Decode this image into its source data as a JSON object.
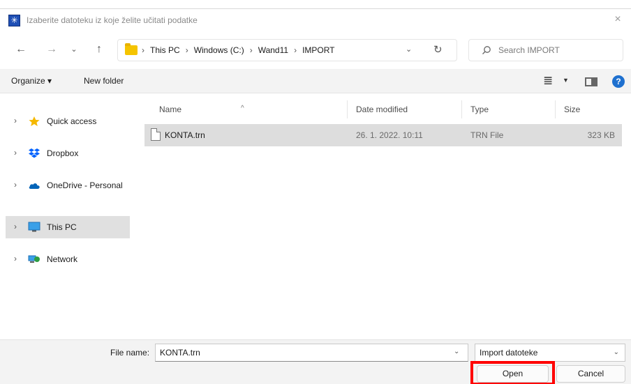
{
  "titlebar": {
    "title": "Izaberite datoteku iz koje želite učitati podatke",
    "close_glyph": "×",
    "app_icon_glyph": "✳"
  },
  "nav": {
    "back_glyph": "←",
    "forward_glyph": "→",
    "recent_glyph": "⌄",
    "up_glyph": "↑",
    "breadcrumbs": [
      "This PC",
      "Windows (C:)",
      "Wand11",
      "IMPORT"
    ],
    "crumb_sep": "›",
    "leading_sep": "›",
    "address_dropdown_glyph": "⌄",
    "refresh_glyph": "↻",
    "search_placeholder": "Search IMPORT"
  },
  "toolbar": {
    "organize_label": "Organize ▾",
    "new_folder_label": "New folder",
    "view_glyph": "≣",
    "view_dropdown_glyph": "▼",
    "help_glyph": "?"
  },
  "sidebar": {
    "items": [
      {
        "label": "Quick access",
        "icon": "star-icon",
        "selected": false
      },
      {
        "label": "Dropbox",
        "icon": "dropbox-icon",
        "selected": false
      },
      {
        "label": "OneDrive - Personal",
        "icon": "cloud-icon",
        "selected": false
      },
      {
        "label": "This PC",
        "icon": "monitor-icon",
        "selected": true
      },
      {
        "label": "Network",
        "icon": "network-icon",
        "selected": false
      }
    ],
    "expand_glyph": "›"
  },
  "filelist": {
    "columns": [
      "Name",
      "Date modified",
      "Type",
      "Size"
    ],
    "sort_glyph": "^",
    "rows": [
      {
        "name": "KONTA.trn",
        "date": "26. 1. 2022. 10:11",
        "type": "TRN File",
        "size": "323 KB"
      }
    ]
  },
  "footer": {
    "filename_label": "File name:",
    "filename_value": "KONTA.trn",
    "filename_dropdown_glyph": "⌄",
    "filetype_value": "Import datoteke",
    "filetype_dropdown_glyph": "⌄",
    "open_label": "Open",
    "cancel_label": "Cancel"
  },
  "colors": {
    "highlight": "#ff0000",
    "accent": "#1e70cf",
    "selection": "#dddddd"
  }
}
